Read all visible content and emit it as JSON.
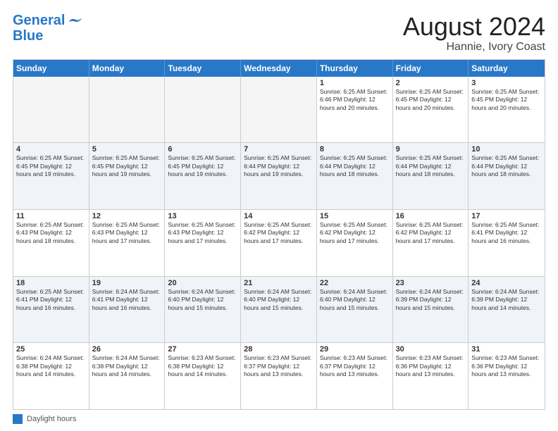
{
  "logo": {
    "line1": "General",
    "line2": "Blue"
  },
  "title": "August 2024",
  "location": "Hannie, Ivory Coast",
  "days_header": [
    "Sunday",
    "Monday",
    "Tuesday",
    "Wednesday",
    "Thursday",
    "Friday",
    "Saturday"
  ],
  "footer_label": "Daylight hours",
  "weeks": [
    [
      {
        "day": "",
        "info": "",
        "empty": true
      },
      {
        "day": "",
        "info": "",
        "empty": true
      },
      {
        "day": "",
        "info": "",
        "empty": true
      },
      {
        "day": "",
        "info": "",
        "empty": true
      },
      {
        "day": "1",
        "info": "Sunrise: 6:25 AM\nSunset: 6:46 PM\nDaylight: 12 hours\nand 20 minutes."
      },
      {
        "day": "2",
        "info": "Sunrise: 6:25 AM\nSunset: 6:45 PM\nDaylight: 12 hours\nand 20 minutes."
      },
      {
        "day": "3",
        "info": "Sunrise: 6:25 AM\nSunset: 6:45 PM\nDaylight: 12 hours\nand 20 minutes."
      }
    ],
    [
      {
        "day": "4",
        "info": "Sunrise: 6:25 AM\nSunset: 6:45 PM\nDaylight: 12 hours\nand 19 minutes."
      },
      {
        "day": "5",
        "info": "Sunrise: 6:25 AM\nSunset: 6:45 PM\nDaylight: 12 hours\nand 19 minutes."
      },
      {
        "day": "6",
        "info": "Sunrise: 6:25 AM\nSunset: 6:45 PM\nDaylight: 12 hours\nand 19 minutes."
      },
      {
        "day": "7",
        "info": "Sunrise: 6:25 AM\nSunset: 6:44 PM\nDaylight: 12 hours\nand 19 minutes."
      },
      {
        "day": "8",
        "info": "Sunrise: 6:25 AM\nSunset: 6:44 PM\nDaylight: 12 hours\nand 18 minutes."
      },
      {
        "day": "9",
        "info": "Sunrise: 6:25 AM\nSunset: 6:44 PM\nDaylight: 12 hours\nand 18 minutes."
      },
      {
        "day": "10",
        "info": "Sunrise: 6:25 AM\nSunset: 6:44 PM\nDaylight: 12 hours\nand 18 minutes."
      }
    ],
    [
      {
        "day": "11",
        "info": "Sunrise: 6:25 AM\nSunset: 6:43 PM\nDaylight: 12 hours\nand 18 minutes."
      },
      {
        "day": "12",
        "info": "Sunrise: 6:25 AM\nSunset: 6:43 PM\nDaylight: 12 hours\nand 17 minutes."
      },
      {
        "day": "13",
        "info": "Sunrise: 6:25 AM\nSunset: 6:43 PM\nDaylight: 12 hours\nand 17 minutes."
      },
      {
        "day": "14",
        "info": "Sunrise: 6:25 AM\nSunset: 6:42 PM\nDaylight: 12 hours\nand 17 minutes."
      },
      {
        "day": "15",
        "info": "Sunrise: 6:25 AM\nSunset: 6:42 PM\nDaylight: 12 hours\nand 17 minutes."
      },
      {
        "day": "16",
        "info": "Sunrise: 6:25 AM\nSunset: 6:42 PM\nDaylight: 12 hours\nand 17 minutes."
      },
      {
        "day": "17",
        "info": "Sunrise: 6:25 AM\nSunset: 6:41 PM\nDaylight: 12 hours\nand 16 minutes."
      }
    ],
    [
      {
        "day": "18",
        "info": "Sunrise: 6:25 AM\nSunset: 6:41 PM\nDaylight: 12 hours\nand 16 minutes."
      },
      {
        "day": "19",
        "info": "Sunrise: 6:24 AM\nSunset: 6:41 PM\nDaylight: 12 hours\nand 16 minutes."
      },
      {
        "day": "20",
        "info": "Sunrise: 6:24 AM\nSunset: 6:40 PM\nDaylight: 12 hours\nand 15 minutes."
      },
      {
        "day": "21",
        "info": "Sunrise: 6:24 AM\nSunset: 6:40 PM\nDaylight: 12 hours\nand 15 minutes."
      },
      {
        "day": "22",
        "info": "Sunrise: 6:24 AM\nSunset: 6:40 PM\nDaylight: 12 hours\nand 15 minutes."
      },
      {
        "day": "23",
        "info": "Sunrise: 6:24 AM\nSunset: 6:39 PM\nDaylight: 12 hours\nand 15 minutes."
      },
      {
        "day": "24",
        "info": "Sunrise: 6:24 AM\nSunset: 6:39 PM\nDaylight: 12 hours\nand 14 minutes."
      }
    ],
    [
      {
        "day": "25",
        "info": "Sunrise: 6:24 AM\nSunset: 6:38 PM\nDaylight: 12 hours\nand 14 minutes."
      },
      {
        "day": "26",
        "info": "Sunrise: 6:24 AM\nSunset: 6:38 PM\nDaylight: 12 hours\nand 14 minutes."
      },
      {
        "day": "27",
        "info": "Sunrise: 6:23 AM\nSunset: 6:38 PM\nDaylight: 12 hours\nand 14 minutes."
      },
      {
        "day": "28",
        "info": "Sunrise: 6:23 AM\nSunset: 6:37 PM\nDaylight: 12 hours\nand 13 minutes."
      },
      {
        "day": "29",
        "info": "Sunrise: 6:23 AM\nSunset: 6:37 PM\nDaylight: 12 hours\nand 13 minutes."
      },
      {
        "day": "30",
        "info": "Sunrise: 6:23 AM\nSunset: 6:36 PM\nDaylight: 12 hours\nand 13 minutes."
      },
      {
        "day": "31",
        "info": "Sunrise: 6:23 AM\nSunset: 6:36 PM\nDaylight: 12 hours\nand 13 minutes."
      }
    ]
  ]
}
